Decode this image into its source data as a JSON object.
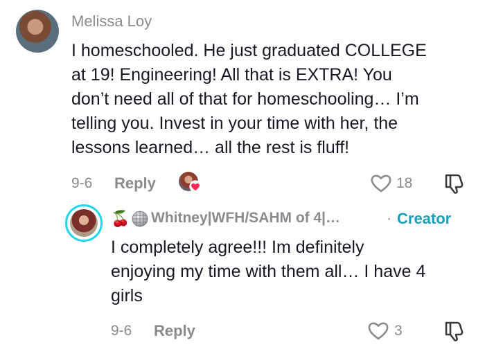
{
  "comment": {
    "author": "Melissa Loy",
    "text_lines": [
      "I homeschooled. He just graduated COLLEGE",
      "at 19! Engineering! All that is EXTRA! You",
      "don’t need all of that for homeschooling… I’m",
      "telling you. Invest in your time with her, the",
      "lessons learned… all the rest is fluff!"
    ],
    "date": "9-6",
    "reply_label": "Reply",
    "likes": "18"
  },
  "reply": {
    "author": "Whitney|WFH/SAHM of 4|…",
    "author_emoji": "🍒",
    "badge_separator": "·",
    "badge": "Creator",
    "text_lines": [
      "I completely agree!!! Im definitely",
      "enjoying my time with them all… I have 4",
      "girls"
    ],
    "date": "9-6",
    "reply_label": "Reply",
    "likes": "3"
  },
  "colors": {
    "text": "#161823",
    "muted": "#8a8a8f",
    "creator": "#1a9fb8",
    "ring": "#20d5ec",
    "heart_badge": "#fe2c55"
  },
  "icons": [
    "heart-icon",
    "dislike-icon",
    "cherry-icon",
    "disco-ball-icon",
    "heart-badge-icon"
  ]
}
